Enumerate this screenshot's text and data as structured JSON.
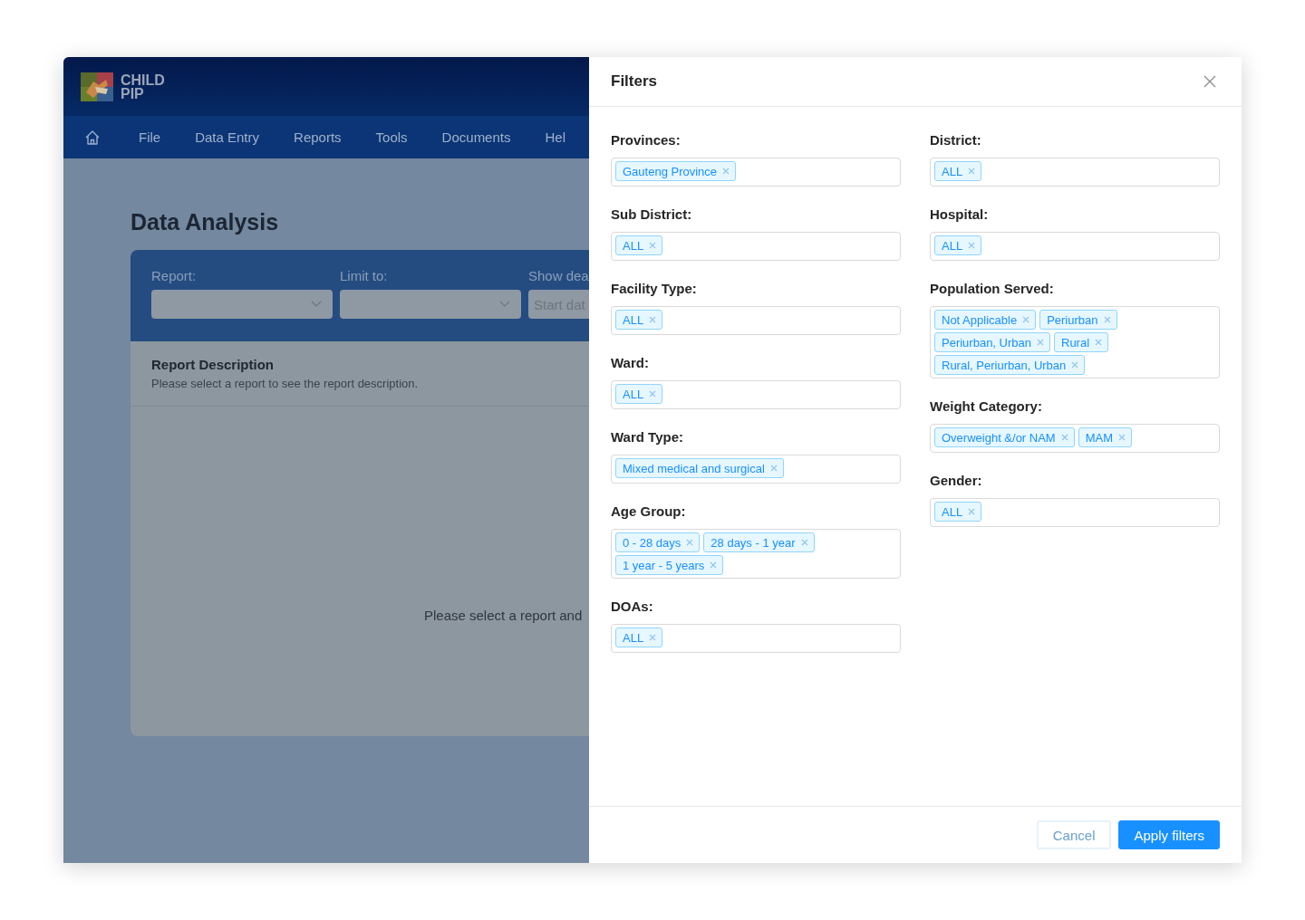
{
  "app": {
    "logo_text": [
      "CHILD",
      "PIP"
    ],
    "nav": [
      {
        "label": "File"
      },
      {
        "label": "Data Entry"
      },
      {
        "label": "Reports"
      },
      {
        "label": "Tools"
      },
      {
        "label": "Documents"
      },
      {
        "label": "Hel"
      }
    ],
    "page_title": "Data Analysis",
    "report_filters": [
      {
        "label": "Report:",
        "kind": "select"
      },
      {
        "label": "Limit to:",
        "kind": "select"
      },
      {
        "label": "Show dea",
        "kind": "date",
        "placeholder": "Start dat"
      }
    ],
    "description": {
      "title": "Report Description",
      "text": "Please select a report to see the report description."
    },
    "empty_message": "Please select a report and"
  },
  "drawer": {
    "title": "Filters",
    "columns": [
      [
        {
          "label": "Provinces:",
          "tags": [
            "Gauteng Province"
          ]
        },
        {
          "label": "Sub District:",
          "tags": [
            "ALL"
          ]
        },
        {
          "label": "Facility Type:",
          "tags": [
            "ALL"
          ]
        },
        {
          "label": "Ward:",
          "tags": [
            "ALL"
          ]
        },
        {
          "label": "Ward Type:",
          "tags": [
            "Mixed medical and surgical"
          ]
        },
        {
          "label": "Age Group:",
          "tags": [
            "0 - 28 days",
            "28 days - 1 year",
            "1 year - 5 years"
          ]
        },
        {
          "label": "DOAs:",
          "tags": [
            "ALL"
          ]
        }
      ],
      [
        {
          "label": "District:",
          "tags": [
            "ALL"
          ]
        },
        {
          "label": "Hospital:",
          "tags": [
            "ALL"
          ]
        },
        {
          "label": "Population Served:",
          "tags": [
            "Not Applicable",
            "Periurban",
            "Periurban, Urban",
            "Rural",
            "Rural, Periurban, Urban"
          ]
        },
        {
          "label": "Weight Category:",
          "tags": [
            "Overweight &/or NAM",
            "MAM"
          ]
        },
        {
          "label": "Gender:",
          "tags": [
            "ALL"
          ]
        }
      ]
    ],
    "buttons": [
      {
        "label": "Cancel",
        "kind": "secondary"
      },
      {
        "label": "Apply filters",
        "kind": "primary"
      }
    ]
  }
}
